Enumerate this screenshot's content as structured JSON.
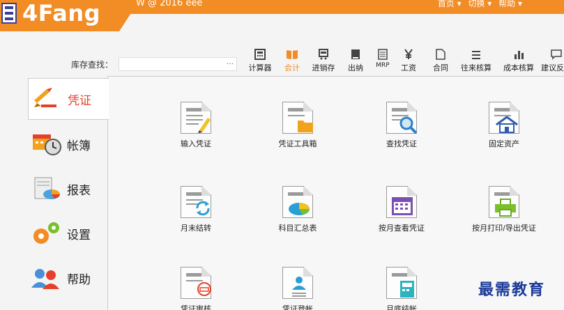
{
  "header": {
    "logo_text": "4Fang",
    "subtitle": "W @ 2016 eee",
    "menu": [
      "首页 ▾",
      "切换 ▾",
      "帮助 ▾"
    ]
  },
  "search": {
    "label": "库存查找：",
    "value": "",
    "more": "…"
  },
  "toolbar": [
    {
      "label": "计算器",
      "icon": "calculator-icon"
    },
    {
      "label": "会计",
      "icon": "book-icon",
      "active": true
    },
    {
      "label": "进销存",
      "icon": "cart-icon"
    },
    {
      "label": "出纳",
      "icon": "box-icon"
    },
    {
      "label": "MRP",
      "icon": "doc-list-icon"
    },
    {
      "label": "工资",
      "icon": "yen-icon"
    },
    {
      "label": "合同",
      "icon": "page-icon"
    },
    {
      "label": "往来核算",
      "icon": "list-icon"
    },
    {
      "label": "成本核算",
      "icon": "bar-chart-icon"
    },
    {
      "label": "建议反",
      "icon": "chat-icon"
    }
  ],
  "sidebar": [
    {
      "label": "凭证",
      "active": true
    },
    {
      "label": "帐簿"
    },
    {
      "label": "报表"
    },
    {
      "label": "设置"
    },
    {
      "label": "帮助"
    }
  ],
  "grid": [
    {
      "label": "输入凭证"
    },
    {
      "label": "凭证工具箱"
    },
    {
      "label": "查找凭证"
    },
    {
      "label": "固定资产"
    },
    {
      "label": "月末结转"
    },
    {
      "label": "科目汇总表"
    },
    {
      "label": "按月查看凭证"
    },
    {
      "label": "按月打印/导出凭证"
    },
    {
      "label": "凭证审核"
    },
    {
      "label": "凭证登帐"
    },
    {
      "label": "月底结帐"
    }
  ],
  "watermark": "最需教育",
  "colors": {
    "accent": "#f28c25",
    "active_text": "#e5402b",
    "brand_blue": "#3a3f96"
  }
}
